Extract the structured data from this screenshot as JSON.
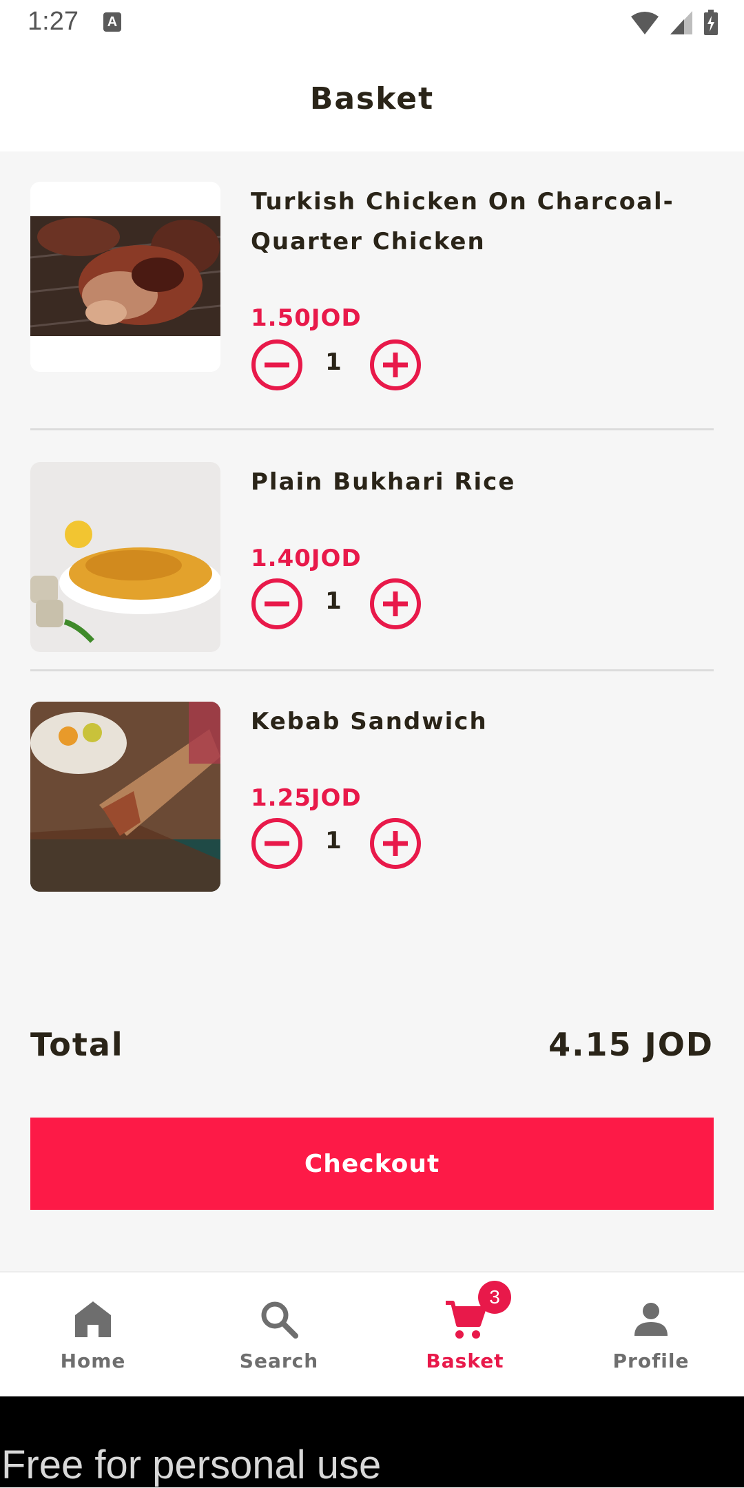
{
  "status_bar": {
    "time": "1:27",
    "icons": [
      "a-notification-icon",
      "wifi-icon",
      "cellular-signal-icon",
      "battery-charging-icon"
    ]
  },
  "header": {
    "title": "Basket"
  },
  "basket": {
    "items": [
      {
        "name": "Turkish Chicken On Charcoal- Quarter Chicken",
        "price": "1.50JOD",
        "quantity": "1",
        "image": "grilled-chicken"
      },
      {
        "name": "Plain Bukhari Rice",
        "price": "1.40JOD",
        "quantity": "1",
        "image": "bukhari-rice"
      },
      {
        "name": "Kebab Sandwich",
        "price": "1.25JOD",
        "quantity": "1",
        "image": "kebab-wrap"
      }
    ]
  },
  "summary": {
    "total_label": "Total",
    "total_value": "4.15 JOD"
  },
  "checkout": {
    "label": "Checkout"
  },
  "bottom_nav": {
    "items": [
      {
        "label": "Home",
        "icon": "home-icon",
        "active": false
      },
      {
        "label": "Search",
        "icon": "search-icon",
        "active": false
      },
      {
        "label": "Basket",
        "icon": "cart-icon",
        "active": true,
        "badge": "3"
      },
      {
        "label": "Profile",
        "icon": "person-icon",
        "active": false
      }
    ]
  },
  "watermark": {
    "text": "Free for personal use"
  },
  "colors": {
    "accent": "#fd1a47",
    "price": "#e8194a",
    "text": "#2a2418",
    "background": "#f6f6f6",
    "nav_inactive": "#6e6e6e"
  }
}
